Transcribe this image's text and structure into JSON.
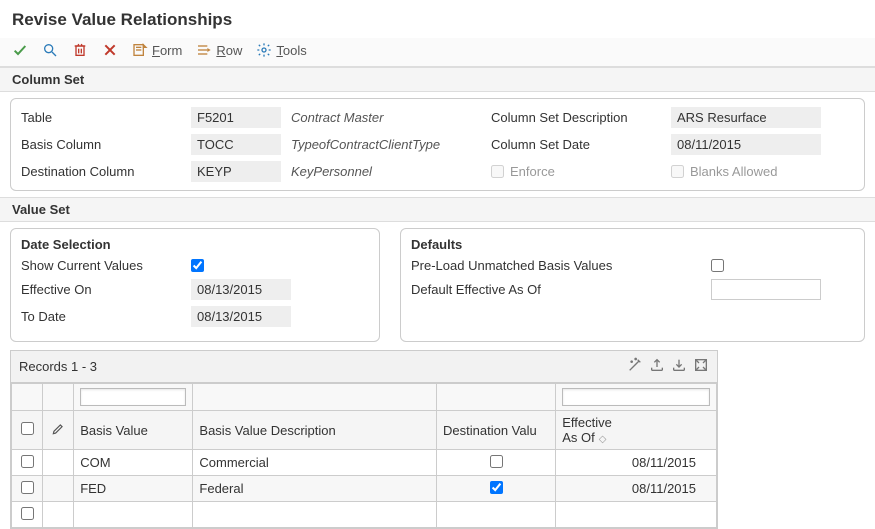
{
  "title": "Revise Value Relationships",
  "toolbar": {
    "form": "Form",
    "row": "Row",
    "tools": "Tools"
  },
  "sections": {
    "column_set": "Column Set",
    "value_set": "Value Set"
  },
  "column_set": {
    "table_label": "Table",
    "table_value": "F5201",
    "table_desc": "Contract Master",
    "basis_label": "Basis Column",
    "basis_value": "TOCC",
    "basis_desc": "TypeofContractClientType",
    "dest_label": "Destination Column",
    "dest_value": "KEYP",
    "dest_desc": "KeyPersonnel",
    "csd_label": "Column Set Description",
    "csd_value": "ARS Resurface",
    "csdate_label": "Column Set Date",
    "csdate_value": "08/11/2015",
    "enforce_label": "Enforce",
    "blanks_label": "Blanks Allowed"
  },
  "date_selection": {
    "title": "Date Selection",
    "show_current_label": "Show Current Values",
    "effective_on_label": "Effective On",
    "effective_on_value": "08/13/2015",
    "to_date_label": "To Date",
    "to_date_value": "08/13/2015"
  },
  "defaults": {
    "title": "Defaults",
    "preload_label": "Pre-Load Unmatched Basis Values",
    "default_eff_label": "Default Effective As Of",
    "default_eff_value": ""
  },
  "grid": {
    "records_label": "Records 1 - 3",
    "headers": {
      "basis_value": "Basis Value",
      "basis_value_desc": "Basis Value Description",
      "dest_value": "Destination Valu",
      "effective": "Effective\nAs Of"
    },
    "rows": [
      {
        "basis_value": "COM",
        "desc": "Commercial",
        "dest_checked": false,
        "effective": "08/11/2015"
      },
      {
        "basis_value": "FED",
        "desc": "Federal",
        "dest_checked": true,
        "effective": "08/11/2015"
      },
      {
        "basis_value": "",
        "desc": "",
        "dest_checked": false,
        "effective": ""
      }
    ]
  }
}
